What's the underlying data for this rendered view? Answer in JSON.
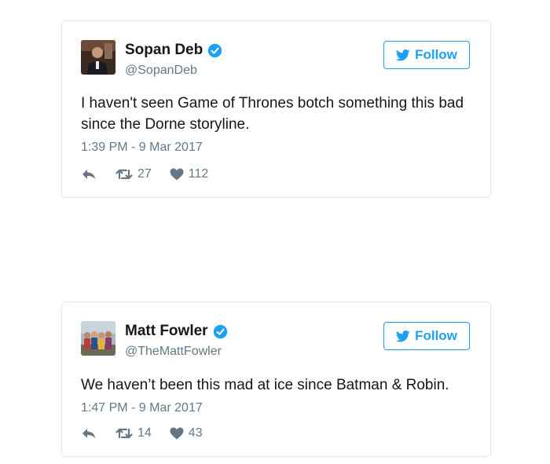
{
  "tweets": [
    {
      "author_name": "Sopan Deb",
      "handle": "@SopanDeb",
      "follow_label": "Follow",
      "text": "I haven't seen Game of Thrones botch something this bad since the Dorne storyline.",
      "timestamp": "1:39 PM - 9 Mar 2017",
      "retweets": "27",
      "likes": "112",
      "verified": true,
      "avatar_icon": "person-photo-avatar"
    },
    {
      "author_name": "Matt Fowler",
      "handle": "@TheMattFowler",
      "follow_label": "Follow",
      "text": "We haven’t been this mad at ice since Batman & Robin.",
      "timestamp": "1:47 PM - 9 Mar 2017",
      "retweets": "14",
      "likes": "43",
      "verified": true,
      "avatar_icon": "group-photo-avatar"
    }
  ],
  "colors": {
    "accent": "#1da1f2",
    "text": "#14171a",
    "muted": "#657786",
    "border": "#e1e8ed"
  },
  "icons": {
    "reply": "reply-icon",
    "retweet": "retweet-icon",
    "like": "heart-icon",
    "verified": "verified-badge-icon",
    "bird": "twitter-bird-icon"
  }
}
